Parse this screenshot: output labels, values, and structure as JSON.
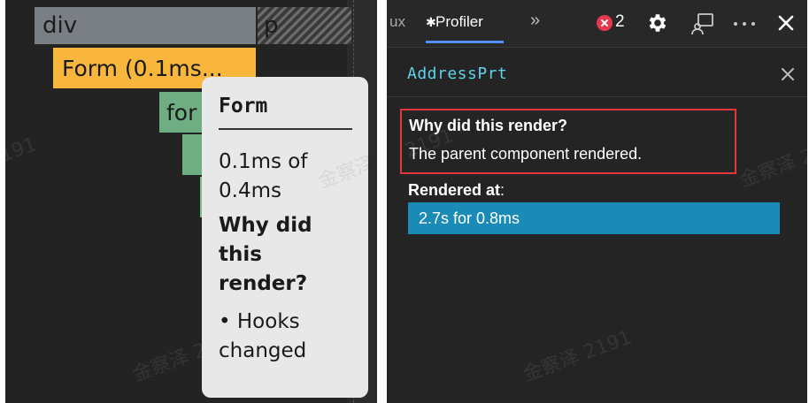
{
  "flame_chart": {
    "bars": {
      "div": "div",
      "p": "p",
      "form": "Form (0.1ms...",
      "for": "for"
    },
    "tooltip": {
      "component": "Form",
      "duration": "0.1ms of 0.4ms",
      "why_title": "Why did this render?",
      "reason": "• Hooks changed"
    },
    "colors": {
      "parent_bar": "#7a7f86",
      "selected_bar": "#f9b63c",
      "child_bar": "#6fae83"
    }
  },
  "devtools": {
    "tabs": {
      "redux": "ux",
      "profiler": "Profiler",
      "profiler_icon": "atom-icon",
      "more_icon": "»"
    },
    "error_count": "2",
    "toolbar_icons": [
      "gear-icon",
      "cast-icon",
      "kebab-icon",
      "close-icon"
    ],
    "component": {
      "name": "AddressPrt"
    },
    "why_render": {
      "title": "Why did this render?",
      "reason": "The parent component rendered."
    },
    "rendered_at": {
      "label": "Rendered at",
      "suffix": ":",
      "entries": [
        "2.7s for 0.8ms"
      ]
    },
    "colors": {
      "accent": "#5fd3ea",
      "highlight_border": "#e5373f",
      "render_entry_bg": "#1a8ab6",
      "error_badge": "#e8384f"
    }
  },
  "watermark": "金察泽 2191"
}
